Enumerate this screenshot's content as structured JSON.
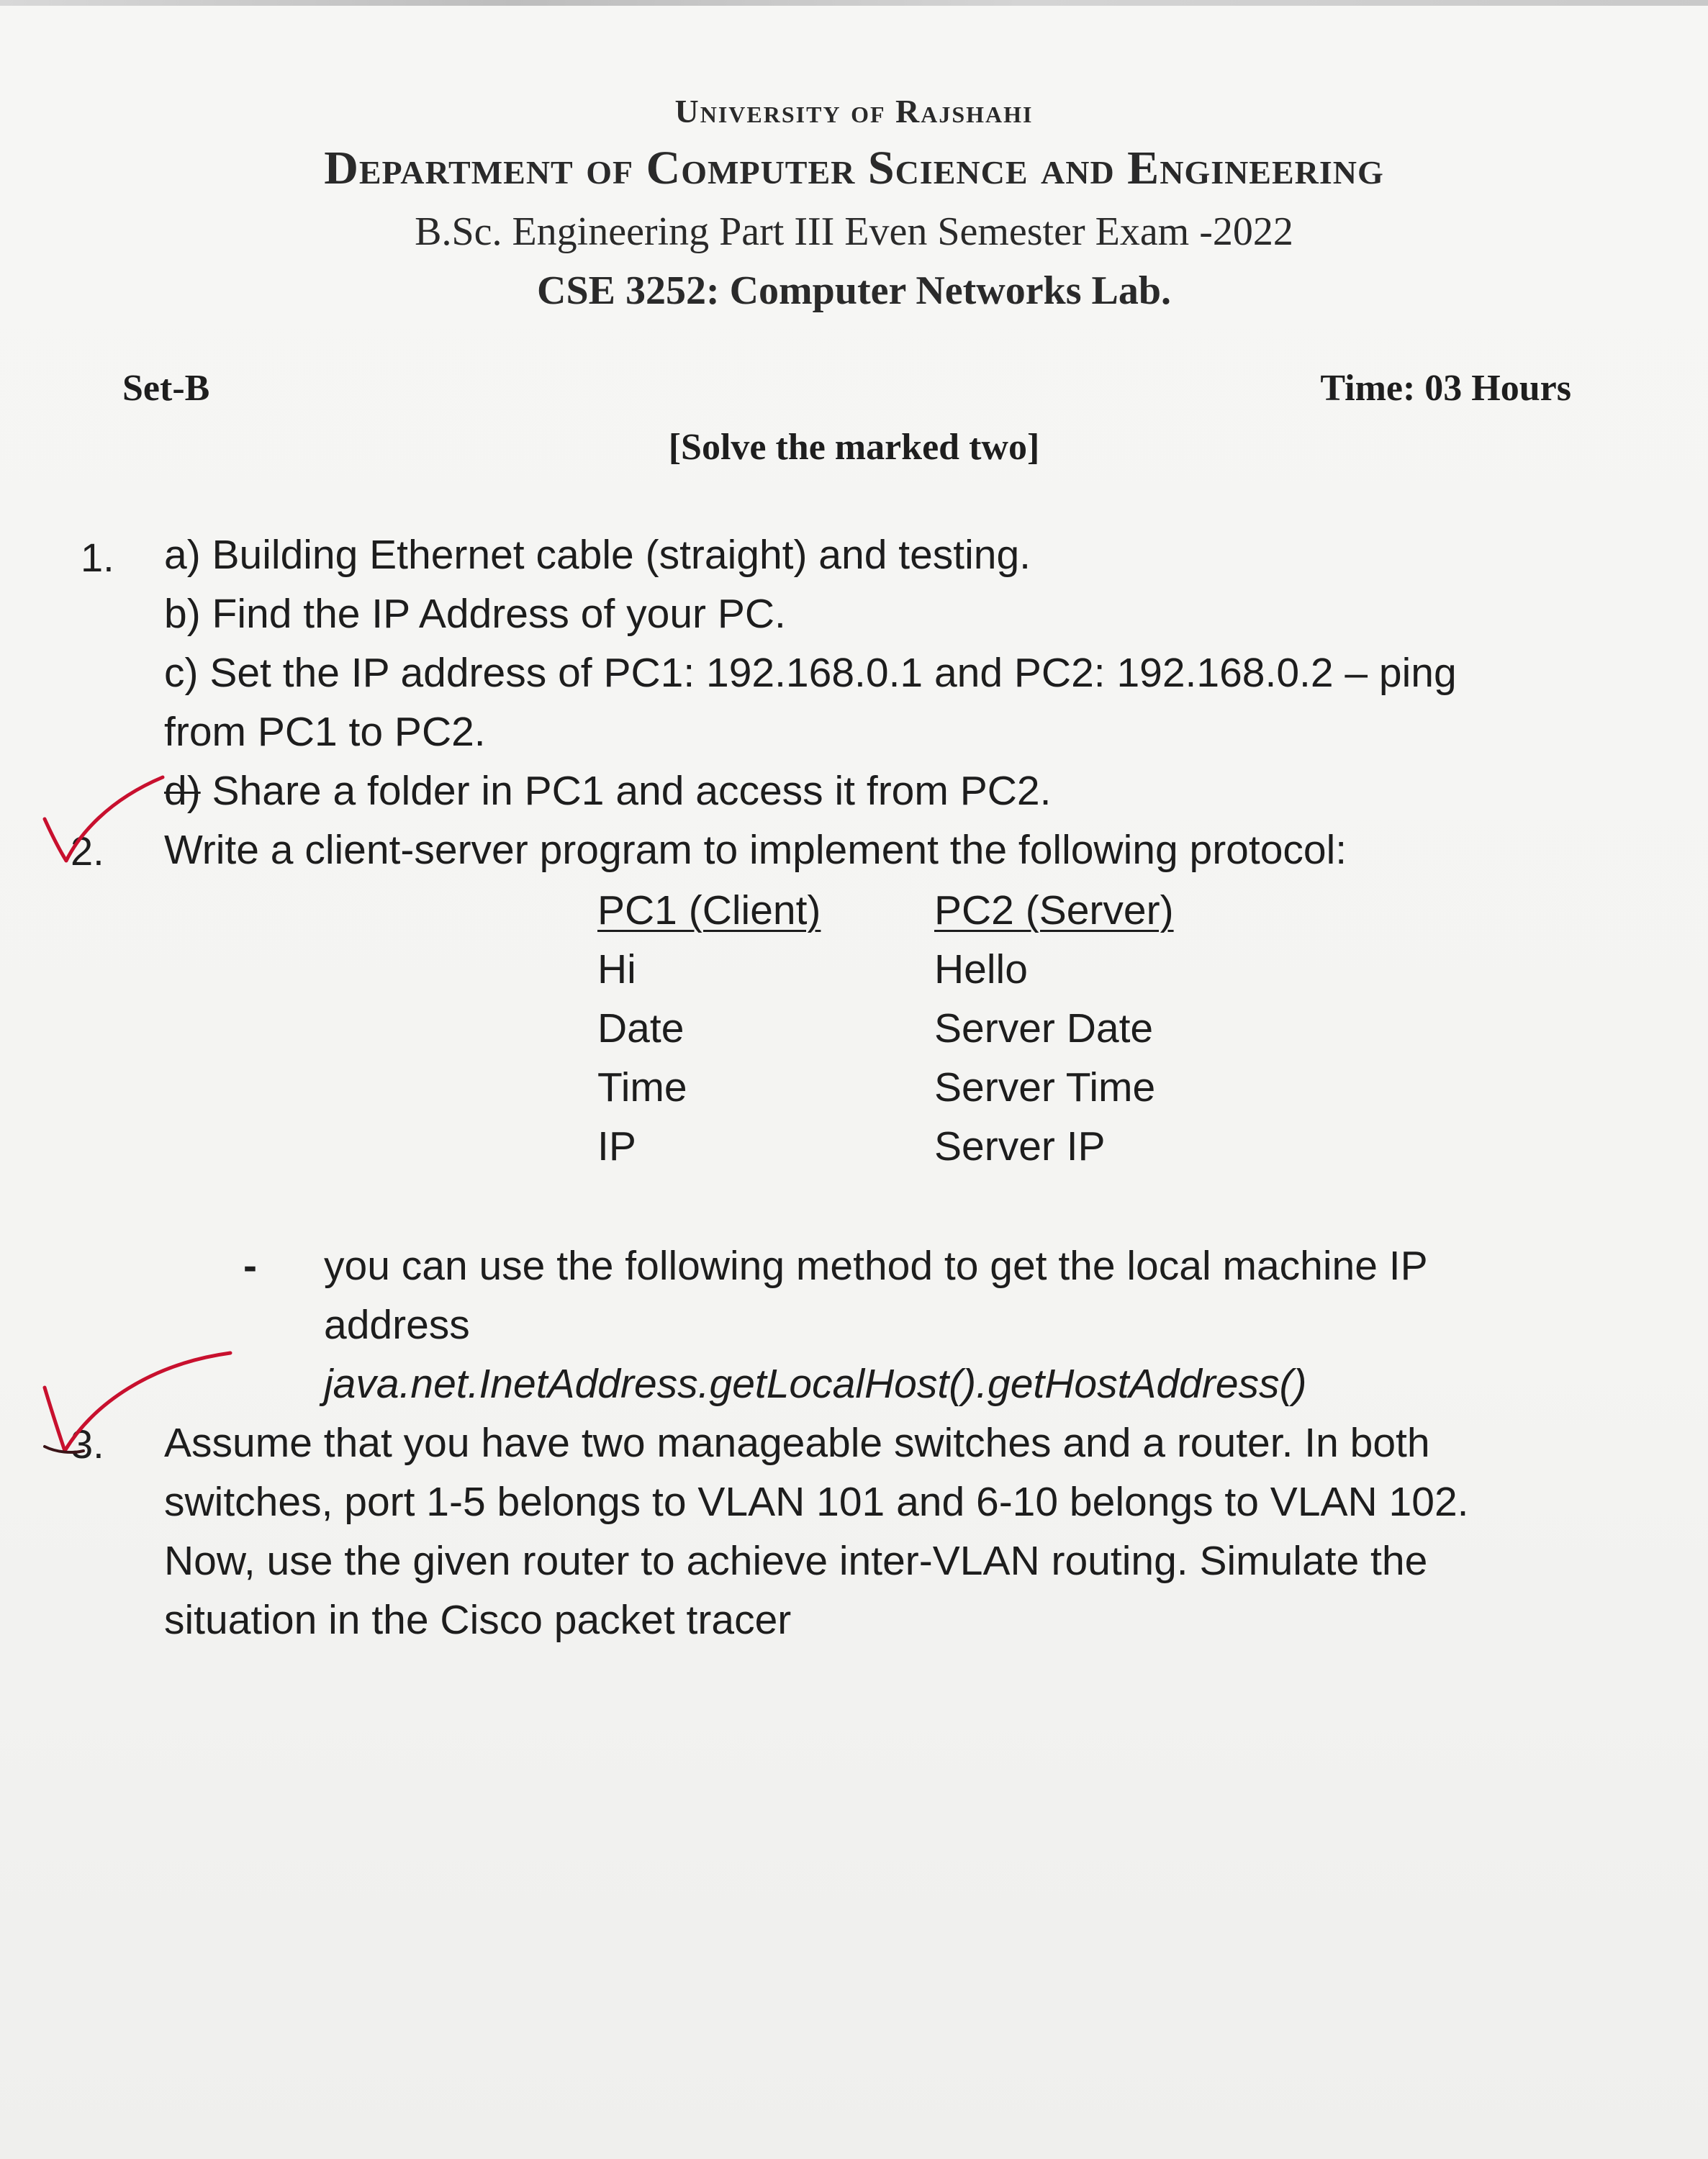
{
  "header": {
    "university": "University of Rajshahi",
    "department": "Department of Computer Science and Engineering",
    "exam": "B.Sc. Engineering Part III Even Semester Exam -2022",
    "course": "CSE 3252: Computer Networks Lab."
  },
  "meta": {
    "set": "Set-B",
    "time": "Time: 03 Hours",
    "instruction": "[Solve the marked two]"
  },
  "q1": {
    "number": "1.",
    "a": "a) Building Ethernet cable (straight) and testing.",
    "b": "b) Find the IP Address of your PC.",
    "c_line1": "c) Set the IP address of PC1: 192.168.0.1 and PC2: 192.168.0.2 – ping",
    "c_line2": "from PC1 to PC2.",
    "d_prefix": "d)",
    "d_text": " Share a folder in PC1 and access it from PC2."
  },
  "q2": {
    "number": "2.",
    "text": "Write a client-server program to implement the following protocol:",
    "table": {
      "headers": [
        "PC1 (Client)",
        "PC2 (Server)"
      ],
      "rows": [
        [
          "Hi",
          "Hello"
        ],
        [
          "Date",
          "Server Date"
        ],
        [
          "Time",
          "Server Time"
        ],
        [
          "IP",
          "Server IP"
        ]
      ]
    },
    "note_bullet": "-",
    "note_line1": "you can use the following method to get the local machine IP",
    "note_line2": "address",
    "code": "java.net.InetAddress.getLocalHost().getHostAddress()"
  },
  "q3": {
    "number": "3.",
    "line1": "Assume that you have two manageable switches and a router. In both",
    "line2": "switches, port 1-5 belongs to VLAN 101 and 6-10 belongs to VLAN 102.",
    "line3": "Now, use the given router to achieve inter-VLAN routing. Simulate the",
    "line4": "situation in the Cisco packet tracer"
  },
  "colors": {
    "ink": "#1e1e1e",
    "tick_mark": "#c8102e"
  }
}
